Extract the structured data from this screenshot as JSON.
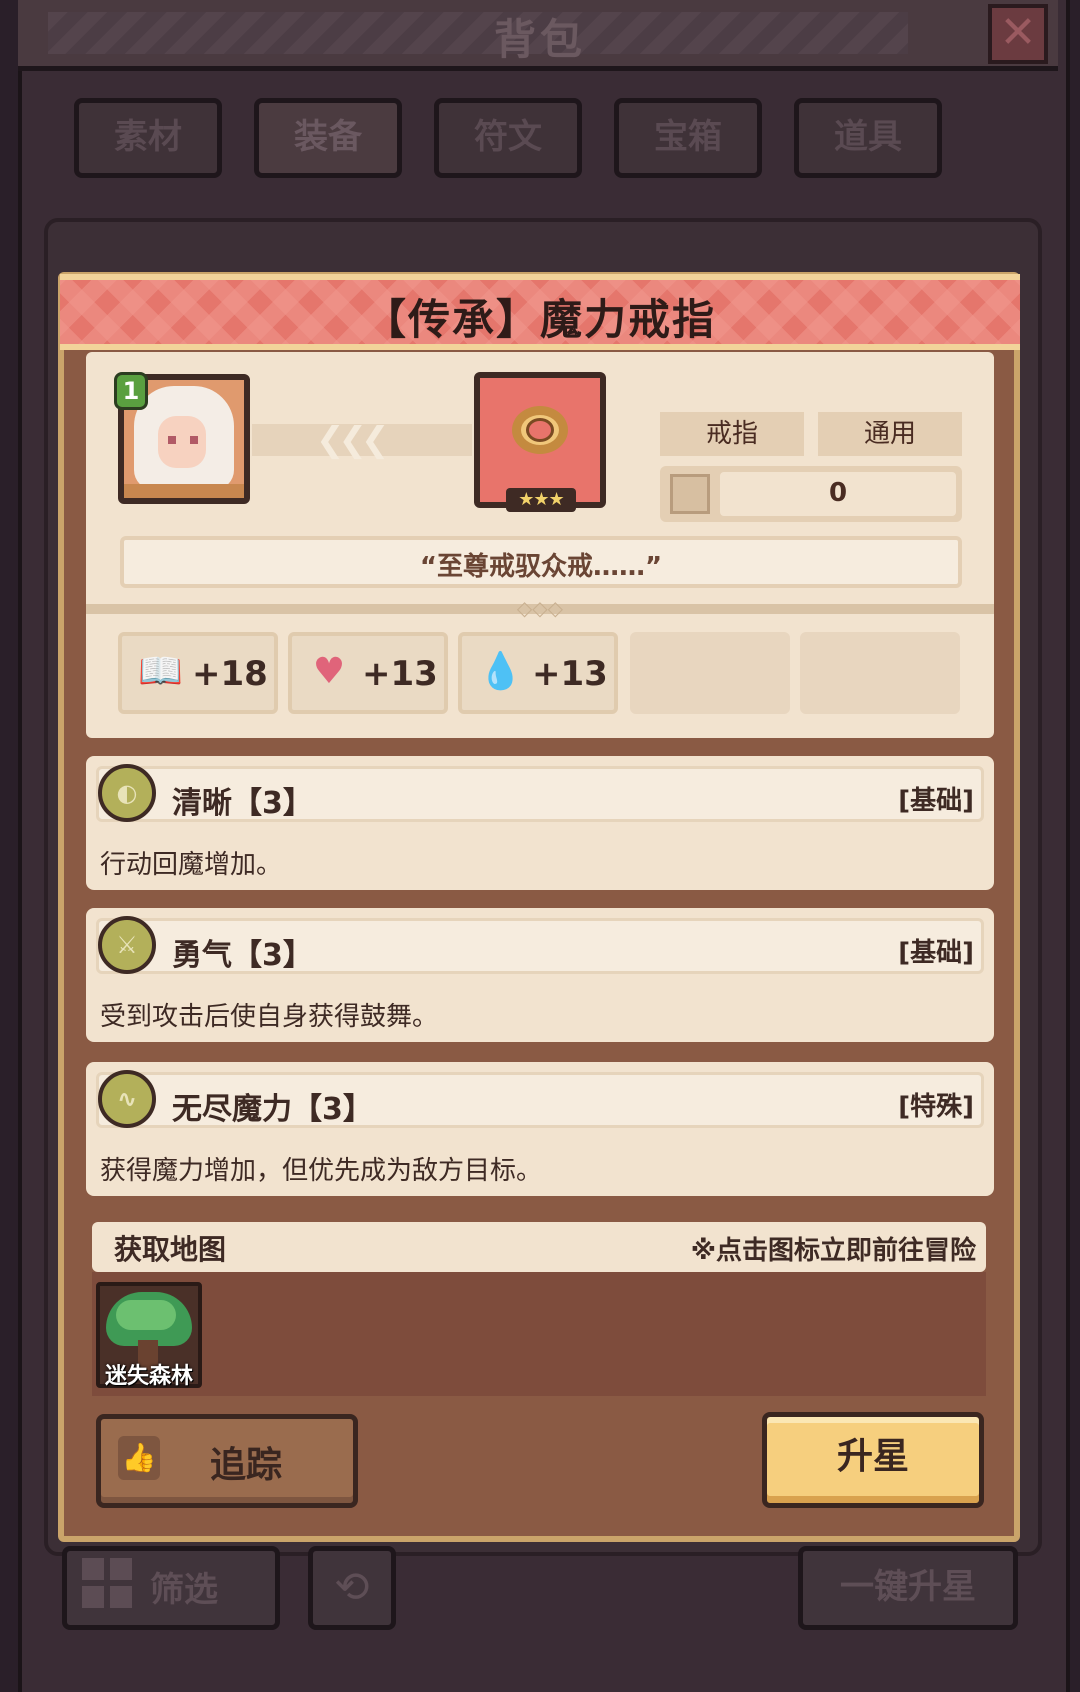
{
  "header": {
    "title": "背包",
    "close_label": "✕"
  },
  "tabs": [
    {
      "label": "素材"
    },
    {
      "label": "装备"
    },
    {
      "label": "符文"
    },
    {
      "label": "宝箱"
    },
    {
      "label": "道具"
    }
  ],
  "item": {
    "title": "【传承】魔力戒指",
    "hero_level": "1",
    "stars": "★★★",
    "tags": [
      "戒指",
      "通用"
    ],
    "count": "0",
    "quote": "“至尊戒驭众戒……”",
    "stats": [
      {
        "icon": "book-icon",
        "glyph": "📖",
        "value": "+18"
      },
      {
        "icon": "heart-icon",
        "glyph": "♥",
        "value": "+13"
      },
      {
        "icon": "water-drop-icon",
        "glyph": "💧",
        "value": "+13"
      }
    ]
  },
  "skills": [
    {
      "icon_label": "◐",
      "name": "清晰【3】",
      "tag": "[基础]",
      "desc": "行动回魔增加。"
    },
    {
      "icon_label": "⚔",
      "name": "勇气【3】",
      "tag": "[基础]",
      "desc": "受到攻击后使自身获得鼓舞。"
    },
    {
      "icon_label": "∿",
      "name": "无尽魔力【3】",
      "tag": "[特殊]",
      "desc": "获得魔力增加，但优先成为敌方目标。"
    }
  ],
  "source": {
    "label": "获取地图",
    "hint": "※点击图标立即前往冒险",
    "maps": [
      {
        "name": "迷失森林"
      }
    ]
  },
  "actions": {
    "track": "追踪",
    "upstar": "升星"
  },
  "footer": {
    "filter": "筛选",
    "refresh": "⟲",
    "onekey": "一键升星"
  },
  "colors": {
    "header_red": "#e5766c",
    "panel": "#f2e3cf",
    "button_gold": "#f6cf7e",
    "frame_brown": "#8a5a44"
  }
}
